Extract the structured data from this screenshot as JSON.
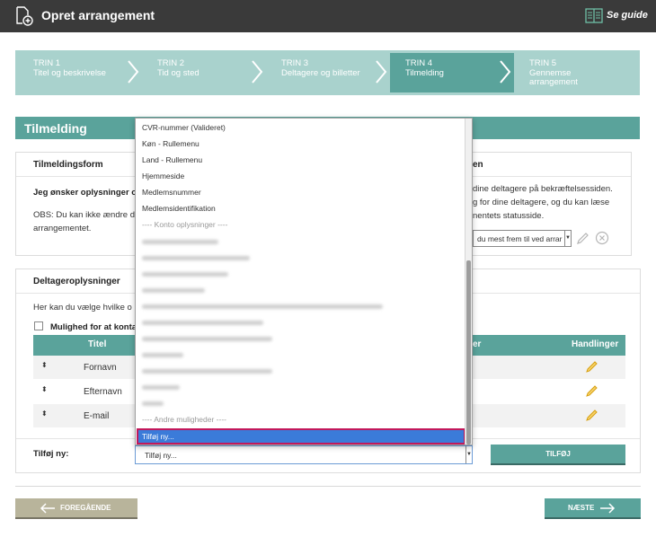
{
  "app": {
    "title": "Opret arrangement",
    "guide_label": "Se guide"
  },
  "steps": [
    {
      "num": "TRIN 1",
      "label": "Titel og beskrivelse"
    },
    {
      "num": "TRIN 2",
      "label": "Tid og sted"
    },
    {
      "num": "TRIN 3",
      "label": "Deltagere og billetter"
    },
    {
      "num": "TRIN 4",
      "label": "Tilmelding"
    },
    {
      "num": "TRIN 5",
      "label": "Gennemse",
      "label2": "arrangement"
    }
  ],
  "section": {
    "title": "Tilmelding"
  },
  "form_panel": {
    "title": "Tilmeldingsform",
    "question": "Jeg ønsker oplysninger o",
    "obs_line1": "OBS: Du kan ikke ændre d",
    "obs_line2": "arrangementet."
  },
  "right_panel": {
    "title_fragment": "en",
    "line1": "dine deltagere på bekræftelsessiden.",
    "line2": "g for dine deltagere, og du kan læse",
    "line3": "nentets statusside.",
    "select_value": "du mest frem til ved arrar"
  },
  "participants": {
    "title": "Deltageroplysninger",
    "intro": "Her kan du vælge hvilke o",
    "checkbox_label": "Mulighed for at konta",
    "col_title": "Titel",
    "col_fragment": "er",
    "col_actions": "Handlinger",
    "rows": [
      {
        "label": "Fornavn"
      },
      {
        "label": "Efternavn"
      },
      {
        "label": "E-mail"
      }
    ],
    "add_label": "Tilføj ny:",
    "add_value": "Tilføj ny...",
    "add_button": "TILFØJ"
  },
  "nav": {
    "prev": "FOREGÅENDE",
    "next": "NÆSTE"
  },
  "dropdown": {
    "options": [
      "CVR-nummer (Valideret)",
      "Køn - Rullemenu",
      "Land - Rullemenu",
      "Hjemmeside",
      "Medlemsnummer",
      "Medlemsidentifikation",
      "---- Konto oplysninger ----"
    ],
    "separator2": "---- Andre muligheder ----",
    "selected": "Tilføj ny..."
  },
  "colors": {
    "accent": "#5aa39b",
    "accent_light": "#a9d2cd",
    "topbar": "#3a3a3a",
    "selected": "#3b7bd9",
    "pencil": "#e8b41c"
  }
}
